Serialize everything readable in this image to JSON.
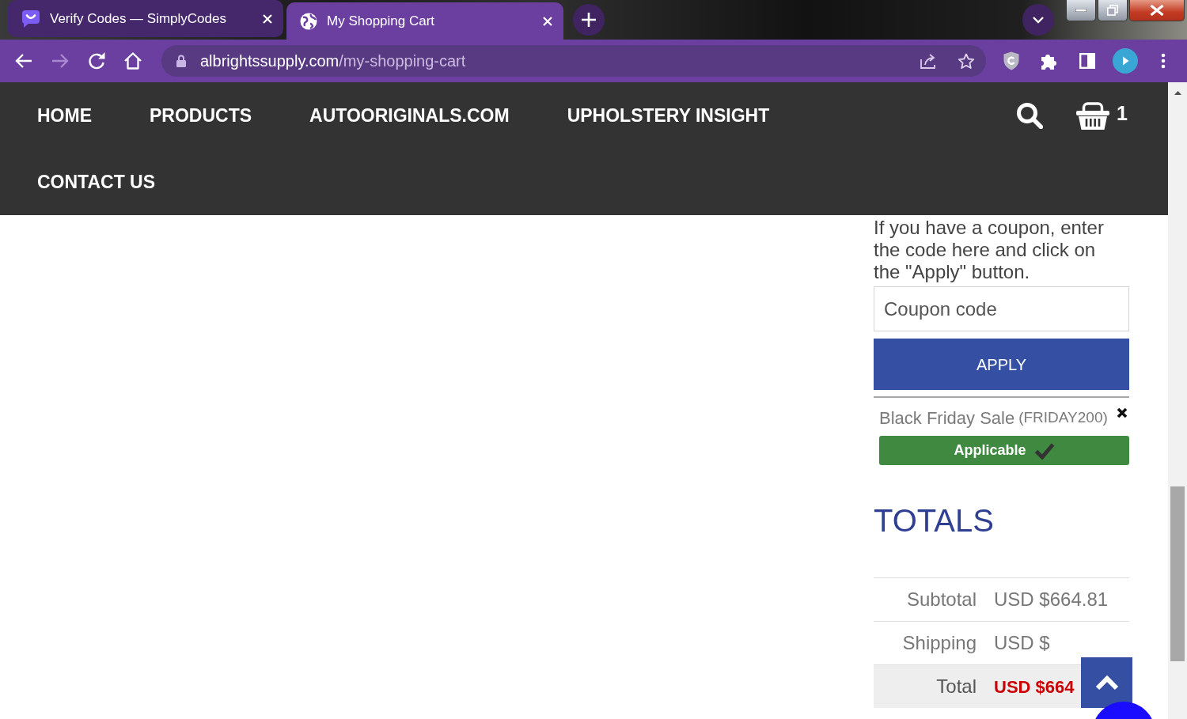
{
  "browser": {
    "tabs": [
      {
        "title": "Verify Codes — SimplyCodes",
        "selected": false
      },
      {
        "title": "My Shopping Cart",
        "selected": true
      }
    ],
    "forward_disabled": true,
    "address": {
      "domain": "albrightssupply.com",
      "path": "/my-shopping-cart"
    }
  },
  "site_nav": {
    "links": [
      "HOME",
      "PRODUCTS",
      "AUTOORIGINALS.COM",
      "UPHOLSTERY INSIGHT",
      "CONTACT US"
    ],
    "cart_count": "1"
  },
  "coupon": {
    "instructions": "If you have a coupon, enter the code here and click on the \"Apply\" button.",
    "placeholder": "Coupon code",
    "button": "APPLY",
    "applied": [
      {
        "name": "Black Friday Sale",
        "code": "(FRIDAY200)",
        "applicable": true,
        "status": "Applicable"
      }
    ]
  },
  "totals": {
    "title": "TOTALS",
    "rows": [
      {
        "kind": "line",
        "label": "Subtotal",
        "value": "USD $664.81"
      },
      {
        "kind": "line",
        "label": "Shipping",
        "value": "USD $"
      },
      {
        "kind": "grand",
        "label": "Total",
        "value": "USD $664"
      }
    ]
  }
}
